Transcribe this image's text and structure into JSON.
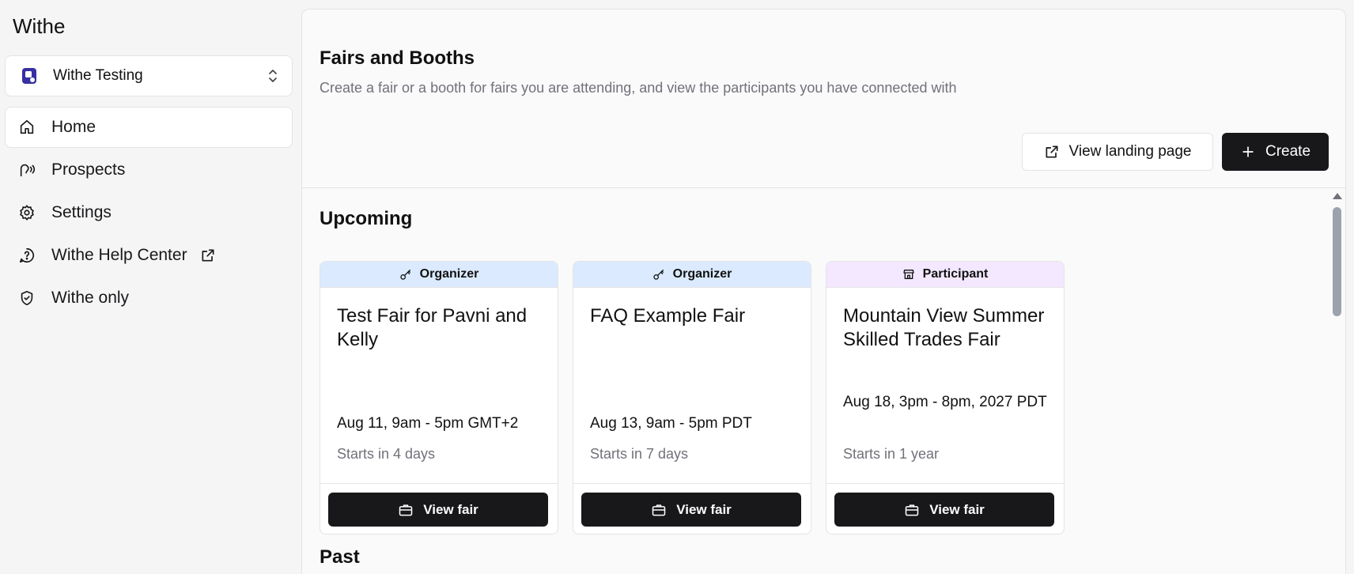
{
  "sidebar": {
    "brand": "Withe",
    "org": {
      "name": "Withe Testing"
    },
    "items": [
      {
        "label": "Home",
        "icon": "home-icon",
        "active": true
      },
      {
        "label": "Prospects",
        "icon": "prospects-icon"
      },
      {
        "label": "Settings",
        "icon": "gear-icon"
      },
      {
        "label": "Withe Help Center",
        "icon": "help-icon",
        "external": true
      },
      {
        "label": "Withe only",
        "icon": "shield-icon"
      }
    ]
  },
  "header": {
    "title": "Fairs and Booths",
    "subtitle": "Create a fair or a booth for fairs you are attending, and view the participants you have connected with",
    "view_landing_label": "View landing page",
    "create_label": "Create"
  },
  "sections": {
    "upcoming": "Upcoming",
    "past": "Past"
  },
  "cards": [
    {
      "role": "Organizer",
      "title": "Test Fair for Pavni and Kelly",
      "date": "Aug 11, 9am - 5pm GMT+2",
      "status": "Starts in 4 days",
      "button": "View fair"
    },
    {
      "role": "Organizer",
      "title": "FAQ Example Fair",
      "date": "Aug 13, 9am - 5pm PDT",
      "status": "Starts in 7 days",
      "button": "View fair"
    },
    {
      "role": "Participant",
      "title": "Mountain View Summer Skilled Trades Fair",
      "date": "Aug 18, 3pm - 8pm, 2027 PDT",
      "status": "Starts in 1 year",
      "button": "View fair"
    }
  ],
  "colors": {
    "primary": "#18181b",
    "organizer_badge": "#dbeafe",
    "participant_badge": "#f3e8ff",
    "muted_text": "#71717a",
    "brand_logo": "#3730a3"
  }
}
